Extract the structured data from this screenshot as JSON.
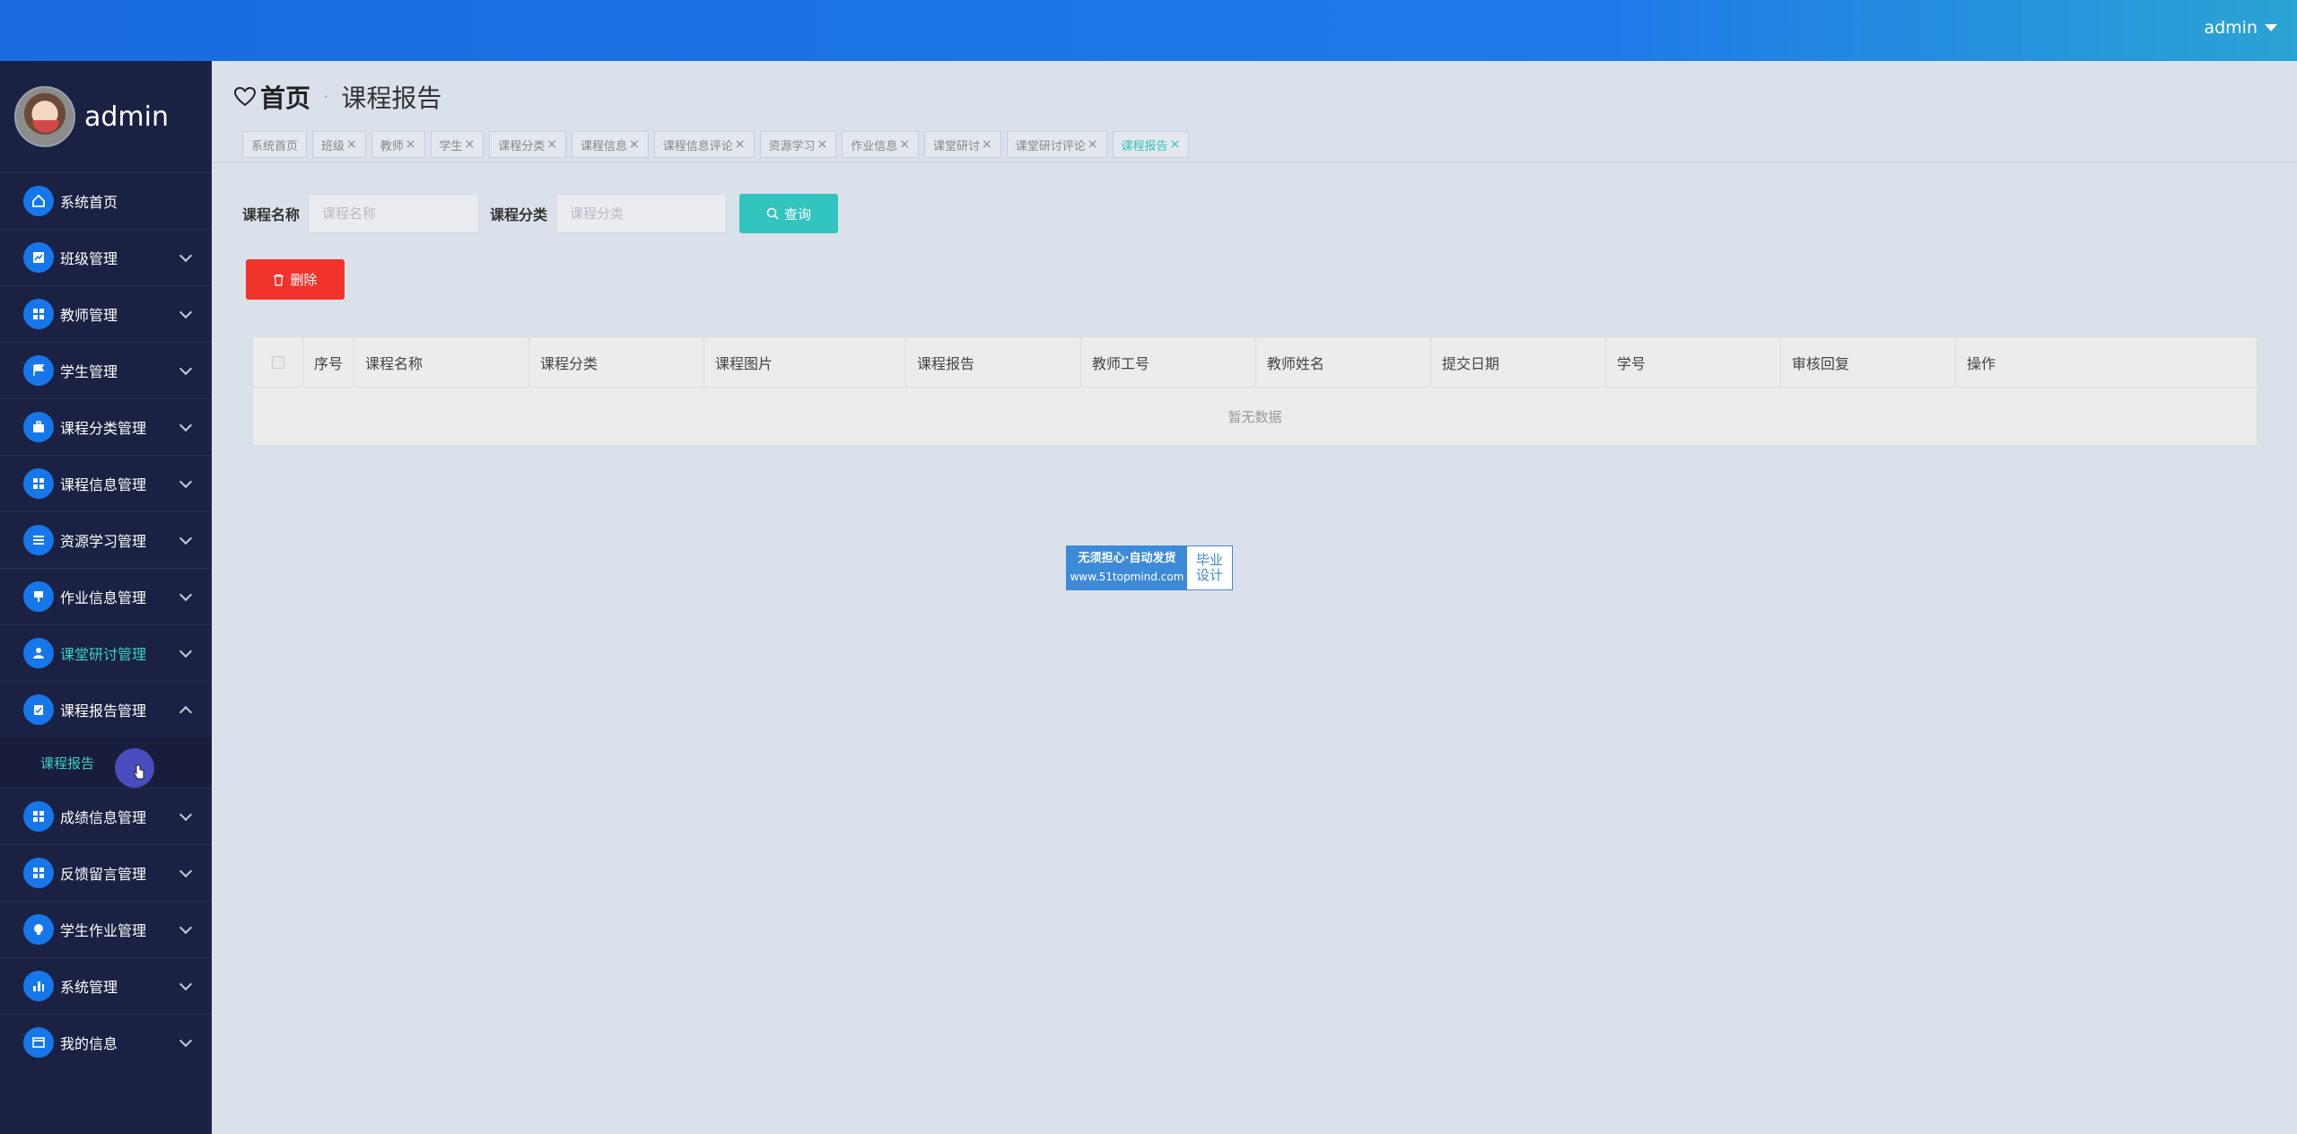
{
  "header": {
    "user": "admin"
  },
  "profile": {
    "name": "admin"
  },
  "sidebar": {
    "items": [
      {
        "label": "系统首页",
        "icon": "home-icon"
      },
      {
        "label": "班级管理",
        "icon": "chart-icon"
      },
      {
        "label": "教师管理",
        "icon": "grid-icon"
      },
      {
        "label": "学生管理",
        "icon": "flag-icon"
      },
      {
        "label": "课程分类管理",
        "icon": "briefcase-icon"
      },
      {
        "label": "课程信息管理",
        "icon": "grid-icon"
      },
      {
        "label": "资源学习管理",
        "icon": "list-icon"
      },
      {
        "label": "作业信息管理",
        "icon": "brush-icon"
      },
      {
        "label": "课堂研讨管理",
        "icon": "user-icon"
      },
      {
        "label": "课程报告管理",
        "icon": "clipboard-icon"
      },
      {
        "label": "成绩信息管理",
        "icon": "grid-icon"
      },
      {
        "label": "反馈留言管理",
        "icon": "grid-icon"
      },
      {
        "label": "学生作业管理",
        "icon": "bulb-icon"
      },
      {
        "label": "系统管理",
        "icon": "bar-chart-icon"
      },
      {
        "label": "我的信息",
        "icon": "card-icon"
      }
    ],
    "submenu": {
      "label": "课程报告"
    }
  },
  "breadcrumb": {
    "home": "首页",
    "current": "课程报告"
  },
  "tabs": [
    "系统首页",
    "班级",
    "教师",
    "学生",
    "课程分类",
    "课程信息",
    "课程信息评论",
    "资源学习",
    "作业信息",
    "课堂研讨",
    "课堂研讨评论",
    "课程报告"
  ],
  "search": {
    "course_name_label": "课程名称",
    "course_name_placeholder": "课程名称",
    "course_category_label": "课程分类",
    "course_category_placeholder": "课程分类",
    "query_label": "查询"
  },
  "actions": {
    "delete_label": "删除"
  },
  "table": {
    "columns": [
      "序号",
      "课程名称",
      "课程分类",
      "课程图片",
      "课程报告",
      "教师工号",
      "教师姓名",
      "提交日期",
      "学号",
      "审核回复",
      "操作"
    ],
    "empty_text": "暂无数据"
  },
  "watermark": {
    "line1": "无须担心·自动发货",
    "line2": "www.51topmind.com",
    "right_line1": "毕业",
    "right_line2": "设计"
  },
  "colors": {
    "accent": "#36d2c6",
    "primary": "#1677ea",
    "danger": "#f0342b",
    "sidebar": "#1b2142"
  }
}
